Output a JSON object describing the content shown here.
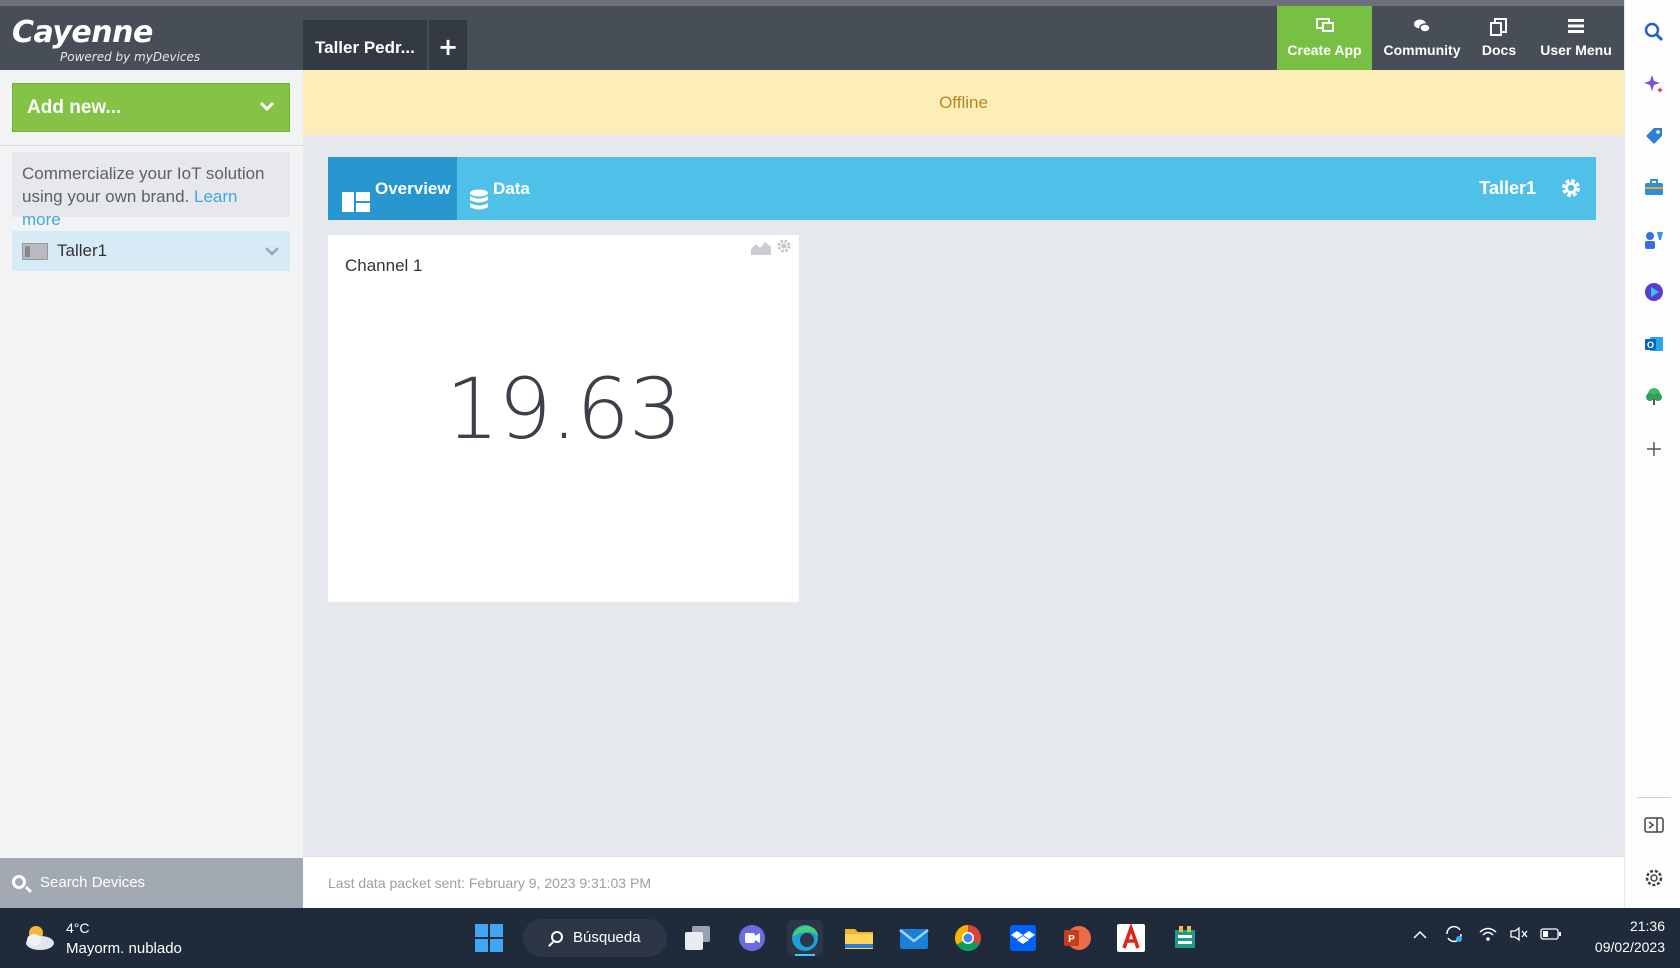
{
  "header": {
    "logo_main": "Cayenne",
    "logo_sub": "Powered by myDevices",
    "project_tab": "Taller Pedr...",
    "add_project": "+",
    "buttons": [
      {
        "label": "Create App",
        "icon": "create-app-icon"
      },
      {
        "label": "Community",
        "icon": "chat-bubbles-icon"
      },
      {
        "label": "Docs",
        "icon": "docs-icon"
      },
      {
        "label": "User Menu",
        "icon": "hamburger-icon"
      }
    ]
  },
  "sidebar": {
    "add_new": "Add new...",
    "promo_text": "Commercialize your IoT solution using your own brand.",
    "promo_link": "Learn more",
    "device": "Taller1",
    "search_placeholder": "Search Devices"
  },
  "status_banner": "Offline",
  "tabs": [
    {
      "label": "Overview",
      "active": true
    },
    {
      "label": "Data",
      "active": false
    }
  ],
  "device_title": "Taller1",
  "widget": {
    "title": "Channel 1",
    "value": "19.63"
  },
  "footer": {
    "last_packet": "Last data packet sent: February 9, 2023 9:31:03 PM"
  },
  "taskbar": {
    "weather_temp": "4°C",
    "weather_desc": "Mayorm. nublado",
    "search_label": "Búsqueda",
    "time": "21:36",
    "date": "09/02/2023"
  },
  "colors": {
    "header_bg": "#484e58",
    "accent_green": "#78c043",
    "tab_bar": "#4fc0e8",
    "tab_active": "#2896cf",
    "offline_bg": "#fdedb9",
    "offline_text": "#b48a23"
  }
}
